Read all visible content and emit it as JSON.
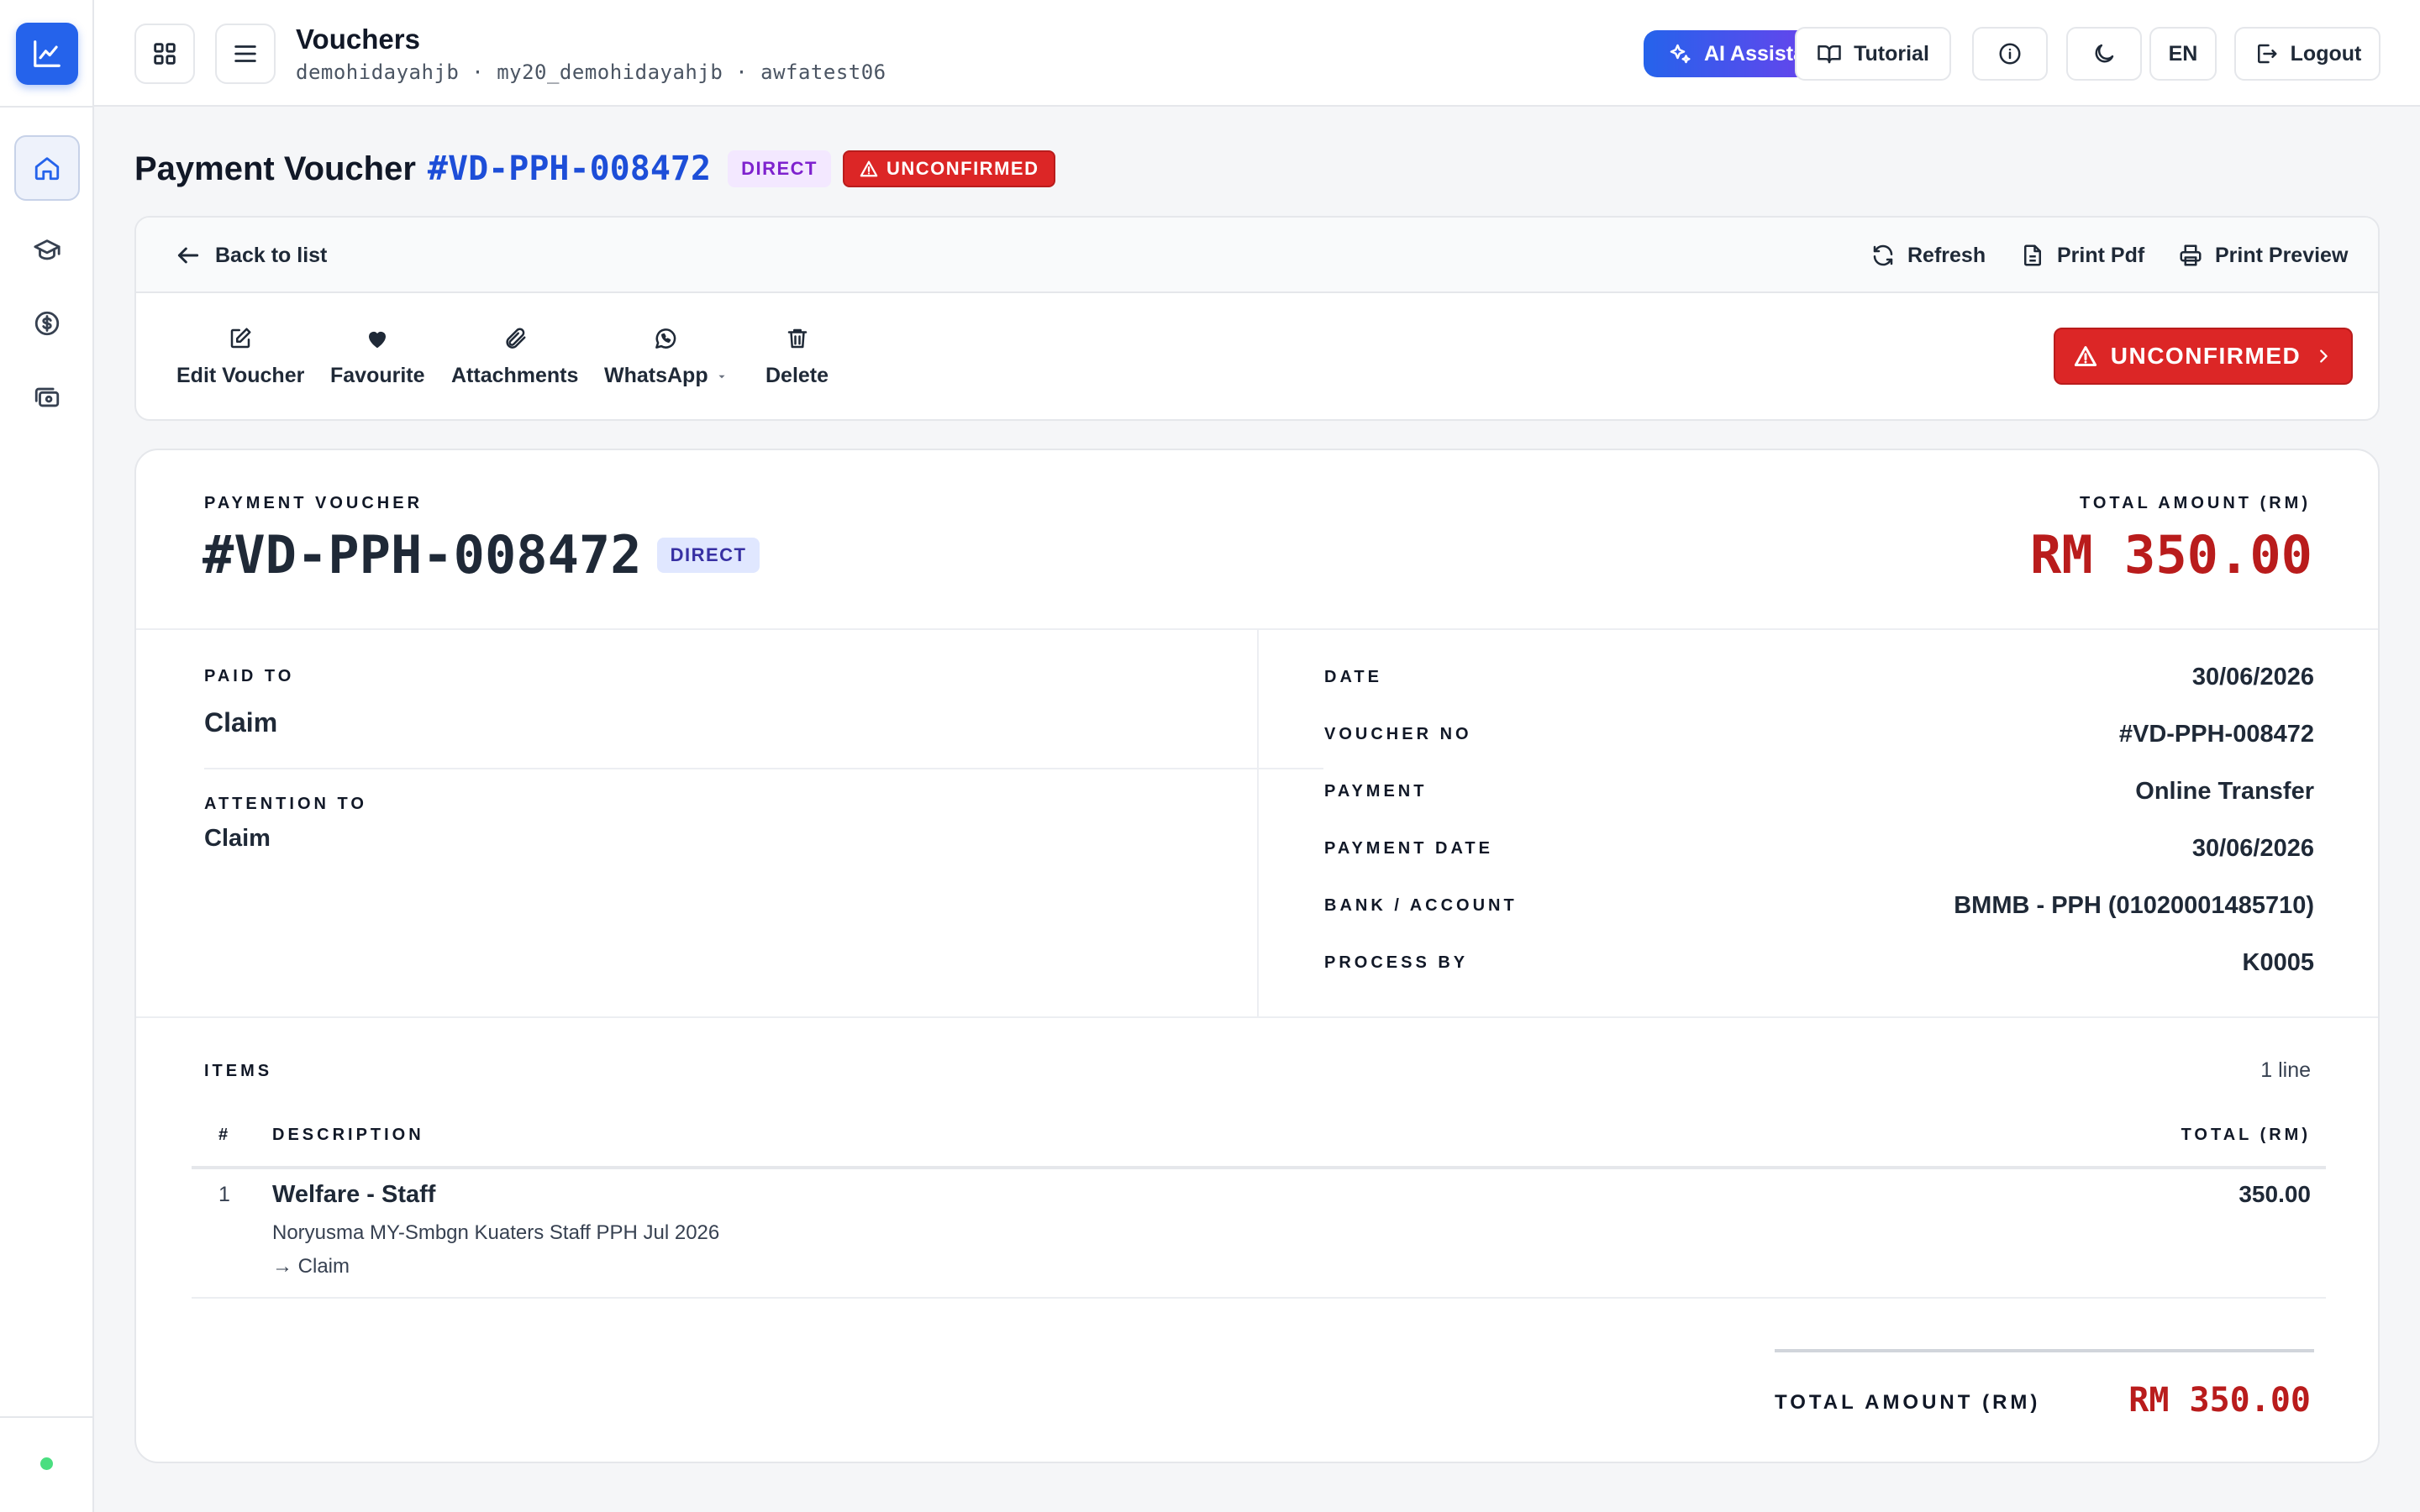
{
  "colors": {
    "accent": "#2563eb",
    "danger": "#dc2626",
    "amount": "#b91c1c",
    "link": "#1d4ed8"
  },
  "sidebar": {
    "logo_icon": "chart-line-icon",
    "items": [
      {
        "icon": "home-icon",
        "active": true
      },
      {
        "icon": "graduation-cap-icon",
        "active": false
      },
      {
        "icon": "dollar-circle-icon",
        "active": false
      },
      {
        "icon": "cash-icon",
        "active": false
      }
    ]
  },
  "header": {
    "title": "Vouchers",
    "subtitle": "demohidayahjb · my20_demohidayahjb · awfatest06",
    "ai_label": "AI Assistant",
    "tutorial_label": "Tutorial",
    "lang_label": "EN",
    "logout_label": "Logout"
  },
  "page": {
    "title_prefix": "Payment Voucher",
    "voucher_id": "#VD-PPH-008472",
    "type_badge": "DIRECT",
    "status_badge": "UNCONFIRMED"
  },
  "actions": {
    "back_label": "Back to list",
    "refresh_label": "Refresh",
    "print_pdf_label": "Print Pdf",
    "print_preview_label": "Print Preview",
    "edit_label": "Edit Voucher",
    "favourite_label": "Favourite",
    "attachments_label": "Attachments",
    "whatsapp_label": "WhatsApp",
    "delete_label": "Delete",
    "status_button_label": "UNCONFIRMED"
  },
  "voucher": {
    "header_label": "PAYMENT VOUCHER",
    "id": "#VD-PPH-008472",
    "type_badge": "DIRECT",
    "total_label": "TOTAL AMOUNT (RM)",
    "total": "RM 350.00",
    "paid_to_label": "PAID TO",
    "paid_to": "Claim",
    "attention_label": "ATTENTION TO",
    "attention": "Claim",
    "details": [
      {
        "label": "DATE",
        "value": "30/06/2026"
      },
      {
        "label": "VOUCHER NO",
        "value": "#VD-PPH-008472"
      },
      {
        "label": "PAYMENT",
        "value": "Online Transfer"
      },
      {
        "label": "PAYMENT DATE",
        "value": "30/06/2026"
      },
      {
        "label": "BANK / ACCOUNT",
        "value": "BMMB - PPH (01020001485710)"
      },
      {
        "label": "PROCESS BY",
        "value": "K0005"
      }
    ]
  },
  "items": {
    "label": "ITEMS",
    "count": "1 line",
    "columns": [
      "#",
      "DESCRIPTION",
      "TOTAL (RM)"
    ],
    "rows": [
      {
        "no": "1",
        "title": "Welfare - Staff",
        "desc": "Noryusma MY-Smbgn Kuaters Staff PPH Jul 2026",
        "note": "→ Claim",
        "total": "350.00"
      }
    ],
    "summary_label": "TOTAL AMOUNT (RM)",
    "summary_value": "RM 350.00"
  }
}
